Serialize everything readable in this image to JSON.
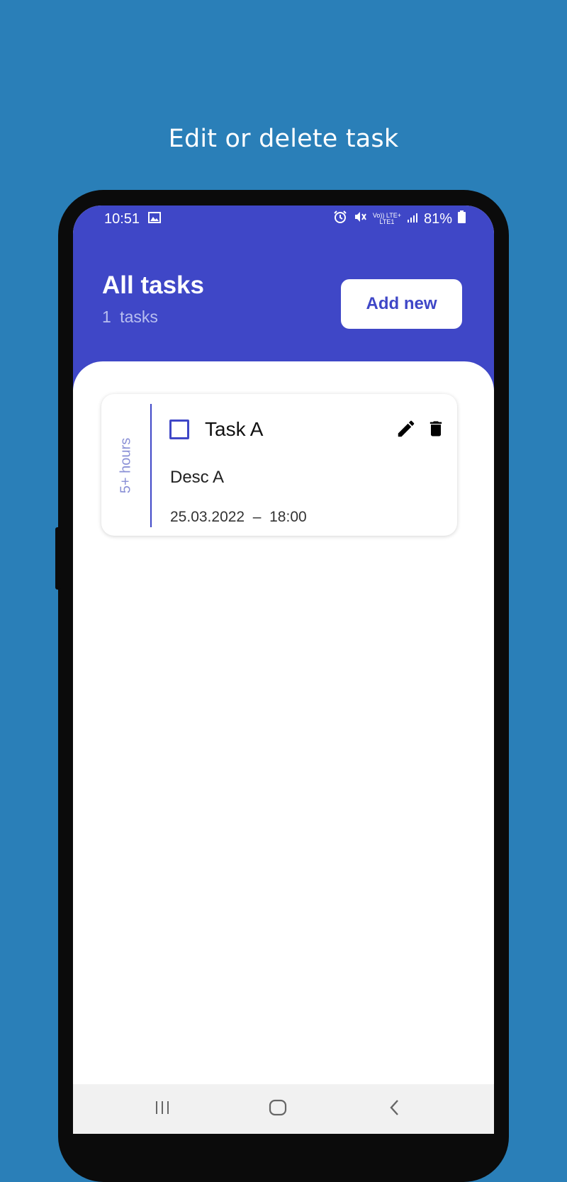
{
  "headline": "Edit or delete task",
  "status_bar": {
    "time": "10:51",
    "network_top": "Vo)) LTE+",
    "network_bottom": "LTE1",
    "battery": "81%"
  },
  "header": {
    "title": "All tasks",
    "task_count": "1 tasks",
    "add_button_label": "Add new"
  },
  "tasks": [
    {
      "duration": "5+ hours",
      "title": "Task A",
      "description": "Desc A",
      "datetime": "25.03.2022  –  18:00",
      "checked": false
    }
  ],
  "colors": {
    "page_background": "#2A7FB8",
    "accent": "#3F47C7",
    "subtitle": "#B9BFF0",
    "duration_text": "#8A90D6"
  },
  "icons": {
    "status_left": [
      "image-icon"
    ],
    "status_right": [
      "alarm-icon",
      "mute-icon",
      "signal-icon",
      "battery-icon"
    ],
    "task_actions": [
      "edit-icon",
      "delete-icon"
    ],
    "navigation": [
      "recent-apps-icon",
      "home-icon",
      "back-icon"
    ]
  }
}
